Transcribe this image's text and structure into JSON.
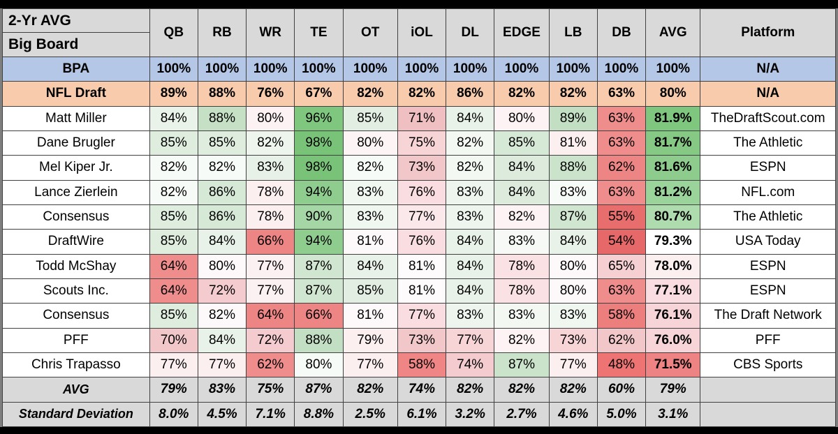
{
  "header": {
    "title_line1": "2-Yr AVG",
    "title_line2": "Big Board",
    "columns": [
      "QB",
      "RB",
      "WR",
      "TE",
      "OT",
      "iOL",
      "DL",
      "EDGE",
      "LB",
      "DB",
      "AVG"
    ],
    "platform_label": "Platform"
  },
  "colors": {
    "header_bg": "#d9d9d9",
    "bpa_bg": "#b4c7e7",
    "nfl_bg": "#f8cbad",
    "green_max": "#7fc67f",
    "red_max": "#ee8383",
    "grid_line": "#404040"
  },
  "chart_data": {
    "type": "table",
    "title": "2-Yr AVG Big Board",
    "categories": [
      "QB",
      "RB",
      "WR",
      "TE",
      "OT",
      "iOL",
      "DL",
      "EDGE",
      "LB",
      "DB",
      "AVG"
    ],
    "rows": [
      {
        "label": "BPA",
        "values": [
          "100%",
          "100%",
          "100%",
          "100%",
          "100%",
          "100%",
          "100%",
          "100%",
          "100%",
          "100%",
          "100%"
        ],
        "platform": "N/A",
        "style": "bpa"
      },
      {
        "label": "NFL Draft",
        "values": [
          "89%",
          "88%",
          "76%",
          "67%",
          "82%",
          "82%",
          "86%",
          "82%",
          "82%",
          "63%",
          "80%"
        ],
        "platform": "N/A",
        "style": "nfl"
      },
      {
        "label": "Matt Miller",
        "values": [
          "84%",
          "88%",
          "80%",
          "96%",
          "85%",
          "71%",
          "84%",
          "80%",
          "89%",
          "63%",
          "81.9%"
        ],
        "platform": "TheDraftScout.com",
        "style": "data"
      },
      {
        "label": "Dane Brugler",
        "values": [
          "85%",
          "85%",
          "82%",
          "98%",
          "80%",
          "75%",
          "82%",
          "85%",
          "81%",
          "63%",
          "81.7%"
        ],
        "platform": "The Athletic",
        "style": "data"
      },
      {
        "label": "Mel Kiper Jr.",
        "values": [
          "82%",
          "82%",
          "83%",
          "98%",
          "82%",
          "73%",
          "82%",
          "84%",
          "88%",
          "62%",
          "81.6%"
        ],
        "platform": "ESPN",
        "style": "data"
      },
      {
        "label": "Lance Zierlein",
        "values": [
          "82%",
          "86%",
          "78%",
          "94%",
          "83%",
          "76%",
          "83%",
          "84%",
          "83%",
          "63%",
          "81.2%"
        ],
        "platform": "NFL.com",
        "style": "data"
      },
      {
        "label": "Consensus",
        "values": [
          "85%",
          "86%",
          "78%",
          "90%",
          "83%",
          "77%",
          "83%",
          "82%",
          "87%",
          "55%",
          "80.7%"
        ],
        "platform": "The Athletic",
        "style": "data"
      },
      {
        "label": "DraftWire",
        "values": [
          "85%",
          "84%",
          "66%",
          "94%",
          "81%",
          "76%",
          "84%",
          "83%",
          "84%",
          "54%",
          "79.3%"
        ],
        "platform": "USA Today",
        "style": "data"
      },
      {
        "label": "Todd McShay",
        "values": [
          "64%",
          "80%",
          "77%",
          "87%",
          "84%",
          "81%",
          "84%",
          "78%",
          "80%",
          "65%",
          "78.0%"
        ],
        "platform": "ESPN",
        "style": "data"
      },
      {
        "label": "Scouts Inc.",
        "values": [
          "64%",
          "72%",
          "77%",
          "87%",
          "85%",
          "81%",
          "84%",
          "78%",
          "80%",
          "63%",
          "77.1%"
        ],
        "platform": "ESPN",
        "style": "data"
      },
      {
        "label": "Consensus",
        "values": [
          "85%",
          "82%",
          "64%",
          "66%",
          "81%",
          "77%",
          "83%",
          "83%",
          "83%",
          "58%",
          "76.1%"
        ],
        "platform": "The Draft Network",
        "style": "data"
      },
      {
        "label": "PFF",
        "values": [
          "70%",
          "84%",
          "72%",
          "88%",
          "79%",
          "73%",
          "77%",
          "82%",
          "73%",
          "62%",
          "76.0%"
        ],
        "platform": "PFF",
        "style": "data"
      },
      {
        "label": "Chris Trapasso",
        "values": [
          "77%",
          "77%",
          "62%",
          "80%",
          "77%",
          "58%",
          "74%",
          "87%",
          "77%",
          "48%",
          "71.5%"
        ],
        "platform": "CBS Sports",
        "style": "data"
      },
      {
        "label": "AVG",
        "values": [
          "79%",
          "83%",
          "75%",
          "87%",
          "82%",
          "74%",
          "82%",
          "82%",
          "82%",
          "60%",
          "79%"
        ],
        "platform": "",
        "style": "summary"
      },
      {
        "label": "Standard Deviation",
        "values": [
          "8.0%",
          "4.5%",
          "7.1%",
          "8.8%",
          "2.5%",
          "6.1%",
          "3.2%",
          "2.7%",
          "4.6%",
          "5.0%",
          "3.1%"
        ],
        "platform": "",
        "style": "summary"
      }
    ],
    "cell_colors": [
      [
        "#b4c7e7",
        "#b4c7e7",
        "#b4c7e7",
        "#b4c7e7",
        "#b4c7e7",
        "#b4c7e7",
        "#b4c7e7",
        "#b4c7e7",
        "#b4c7e7",
        "#b4c7e7",
        "#b4c7e7"
      ],
      [
        "#f8cbad",
        "#f8cbad",
        "#f8cbad",
        "#f8cbad",
        "#f8cbad",
        "#f8cbad",
        "#f8cbad",
        "#f8cbad",
        "#f8cbad",
        "#f8cbad",
        "#f8cbad"
      ],
      [
        "#eaf3ea",
        "#c6e0c6",
        "#fdf2f3",
        "#7fc67f",
        "#e1eee1",
        "#f0bfc1",
        "#e8f2e8",
        "#fdf3f4",
        "#c3dfc3",
        "#ef8d8d",
        "#7fc67f"
      ],
      [
        "#dfeddf",
        "#dfeddf",
        "#edf5ed",
        "#79c379",
        "#fdf4f5",
        "#f7d4d6",
        "#f3f8f3",
        "#d6e8d6",
        "#fbeff0",
        "#ef8d8d",
        "#85c985"
      ],
      [
        "#f7fbf7",
        "#f7fbf7",
        "#e7f1e7",
        "#79c379",
        "#f7fbf7",
        "#f2c7c9",
        "#f3f8f3",
        "#ddebdd",
        "#cbe3cb",
        "#ee8585",
        "#8dcc8d"
      ],
      [
        "#f7fbf7",
        "#d6e8d6",
        "#fbeff0",
        "#8ecd8e",
        "#f0f6f0",
        "#f9dde0",
        "#eef5ee",
        "#ddebdd",
        "#f7fbf7",
        "#ef8d8d",
        "#9ad49a"
      ],
      [
        "#dfeddf",
        "#d6e8d6",
        "#fbeff0",
        "#a5d6a5",
        "#f0f6f0",
        "#fbe8ea",
        "#eef5ee",
        "#fdf3f4",
        "#d0e6d0",
        "#e86d6d",
        "#aedcae"
      ],
      [
        "#dfeddf",
        "#e8f2e8",
        "#ee8585",
        "#8ecd8e",
        "#fdf9fa",
        "#f9dde0",
        "#e8f2e8",
        "#f6f9f6",
        "#e8f2e8",
        "#e76868",
        "#ffffff"
      ],
      [
        "#ef8d8d",
        "#fdf9fa",
        "#fcf1f2",
        "#d0e6d0",
        "#e8f2e8",
        "#fdfbfb",
        "#e8f2e8",
        "#fae2e4",
        "#fdf9fa",
        "#f5cfd2",
        "#fbeff0"
      ],
      [
        "#ef8d8d",
        "#f4cbce",
        "#fcf1f2",
        "#d0e6d0",
        "#e1eee1",
        "#fdfbfb",
        "#e8f2e8",
        "#fae2e4",
        "#fdf9fa",
        "#ef8d8d",
        "#f9dde0"
      ],
      [
        "#dfeddf",
        "#fdf9fa",
        "#ee8585",
        "#ee8585",
        "#fdf9fa",
        "#f9dde0",
        "#eef5ee",
        "#f3f8f3",
        "#f0f6f0",
        "#ec7e7e",
        "#f6d4d7"
      ],
      [
        "#f2c7c9",
        "#e8f2e8",
        "#f4cbce",
        "#c3dfc3",
        "#fbeff0",
        "#f2c7c9",
        "#f7d4d6",
        "#fdf3f4",
        "#f7d4d6",
        "#f2c7c9",
        "#f6d4d7"
      ],
      [
        "#fbeff0",
        "#fbeff0",
        "#ef8d8d",
        "#f7fbf7",
        "#fbeff0",
        "#ef8585",
        "#f4cbce",
        "#cbe3cb",
        "#fbeff0",
        "#ee7474",
        "#ee8383"
      ],
      [
        "#d9d9d9",
        "#d9d9d9",
        "#d9d9d9",
        "#d9d9d9",
        "#d9d9d9",
        "#d9d9d9",
        "#d9d9d9",
        "#d9d9d9",
        "#d9d9d9",
        "#d9d9d9",
        "#d9d9d9"
      ],
      [
        "#d9d9d9",
        "#d9d9d9",
        "#d9d9d9",
        "#d9d9d9",
        "#d9d9d9",
        "#d9d9d9",
        "#d9d9d9",
        "#d9d9d9",
        "#d9d9d9",
        "#d9d9d9",
        "#d9d9d9"
      ]
    ]
  }
}
